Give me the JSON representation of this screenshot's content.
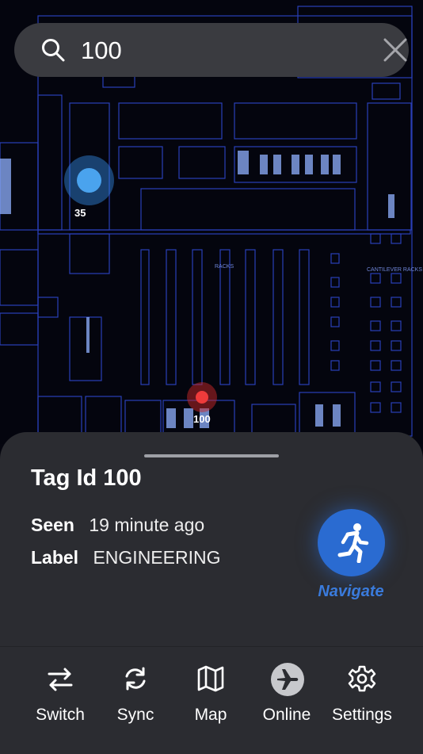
{
  "search": {
    "value": "100",
    "placeholder": "Search"
  },
  "map": {
    "markers": [
      {
        "id": "35",
        "label": "35",
        "color": "#4aa3ee"
      },
      {
        "id": "100",
        "label": "100",
        "color": "#ee3b3b"
      }
    ],
    "floor_labels": [
      "RACKS",
      "CANTILEVER RACKS"
    ]
  },
  "sheet": {
    "title": "Tag Id 100",
    "seen_key": "Seen",
    "seen_value": "19 minute ago",
    "label_key": "Label",
    "label_value": "ENGINEERING",
    "navigate_label": "Navigate",
    "navigate_icon": "running-person-icon",
    "accent": "#2a6bd1"
  },
  "tabs": [
    {
      "label": "Switch",
      "icon": "switch-arrows-icon"
    },
    {
      "label": "Sync",
      "icon": "sync-icon"
    },
    {
      "label": "Map",
      "icon": "map-icon"
    },
    {
      "label": "Online",
      "icon": "airplane-icon"
    },
    {
      "label": "Settings",
      "icon": "gear-icon"
    }
  ]
}
